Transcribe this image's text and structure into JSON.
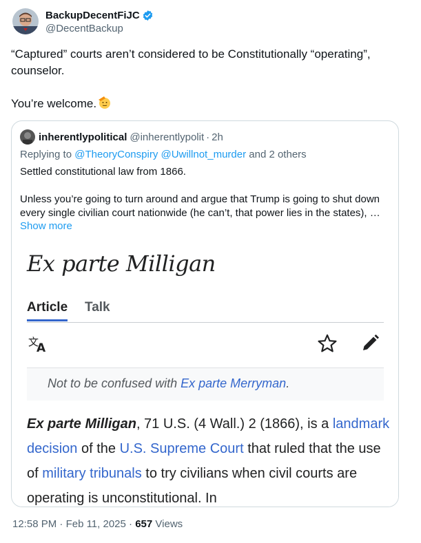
{
  "author": {
    "display_name": "BackupDecentFiJC",
    "handle": "@DecentBackup",
    "verified": true
  },
  "tweet": {
    "line1": "“Captured” courts aren’t considered to be Constitutionally “operating”, counselor.",
    "line2": "You’re welcome.",
    "emoji": "saluting-face"
  },
  "quoted": {
    "display_name": "inherentlypolitical",
    "handle": "@inherentlypolit",
    "separator": "·",
    "time": "2h",
    "reply_prefix": "Replying to",
    "reply_mentions": "@TheoryConspiry @Uwillnot_murder",
    "reply_suffix": "and 2 others",
    "body_line1": "Settled constitutional law from 1866.",
    "body_line2": "Unless you’re going to turn around and argue that Trump is going to shut down every single civilian court nationwide (he can’t, that power lies in the states), …",
    "show_more": "Show more",
    "wiki": {
      "title": "Ex parte Milligan",
      "tab_article": "Article",
      "tab_talk": "Talk",
      "hatnote_prefix": "Not to be confused with",
      "hatnote_link": "Ex parte Merryman",
      "hatnote_suffix": ".",
      "para_bold": "Ex parte Milligan",
      "para_1": ", 71 U.S. (4 Wall.) 2 (1866), is a",
      "link_landmark": "landmark decision",
      "para_2": "of the",
      "link_court": "U.S. Supreme Court",
      "para_3": "that ruled that the use of",
      "link_tribunals": "military tribunals",
      "para_4": "to try civilians when civil courts are operating is unconstitutional. In"
    }
  },
  "footer": {
    "time": "12:58 PM",
    "separator": "·",
    "date": "Feb 11, 2025",
    "views_count": "657",
    "views_label": "Views"
  },
  "colors": {
    "link": "#1d9bf0",
    "wiki_link": "#3366cc",
    "secondary_text": "#536471",
    "verified_badge": "#1d9bf0"
  }
}
